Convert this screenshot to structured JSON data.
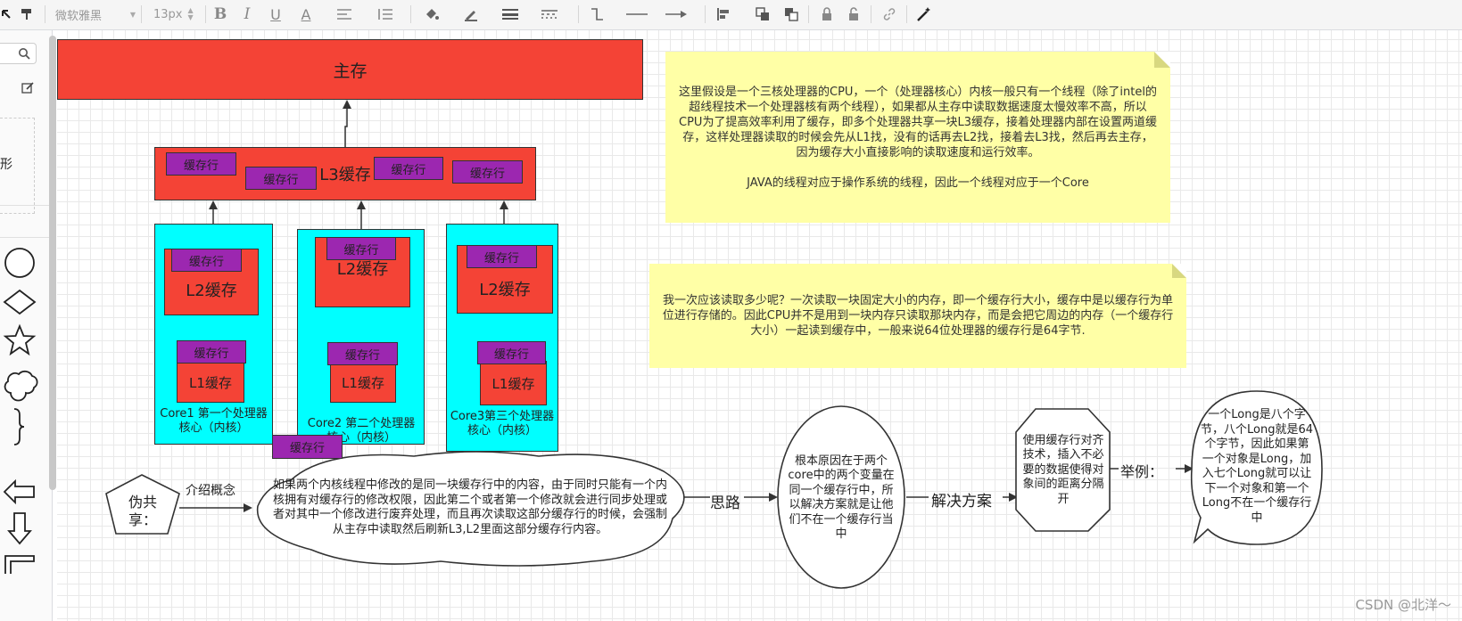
{
  "toolbar": {
    "font_family": "微软雅黑",
    "font_size": "13px"
  },
  "left_panel": {
    "shape_label": "形"
  },
  "main_memory": "主存",
  "l3": {
    "label": "L3缓存",
    "cache_lines": [
      "缓存行",
      "缓存行",
      "缓存行",
      "缓存行"
    ]
  },
  "cores": [
    {
      "label": "Core1 第一个处理器核心（内核）",
      "l2": "L2缓存",
      "l2_line": "缓存行",
      "l1": "L1缓存",
      "l1_line": "缓存行"
    },
    {
      "label": "Core2 第二个处理器核心（内核）",
      "l2": "L2缓存",
      "l2_line": "缓存行",
      "l1": "L1缓存",
      "l1_line": "缓存行"
    },
    {
      "label": "Core3第三个处理器核心（内核）",
      "l2": "L2缓存",
      "l2_line": "缓存行",
      "l1": "L1缓存",
      "l1_line": "缓存行"
    }
  ],
  "loose_cache_line": "缓存行",
  "notes": {
    "note1_p1": "这里假设是一个三核处理器的CPU，一个（处理器核心）内核一般只有一个线程（除了intel的超线程技术一个处理器核有两个线程），如果都从主存中读取数据速度太慢效率不高，所以CPU为了提高效率利用了缓存，即多个处理器共享一块L3缓存，接着处理器内部在设置两道缓存，这样处理器读取的时候会先从L1找，没有的话再去L2找，接着去L3找，然后再去主存，因为缓存大小直接影响的读取速度和运行效率。",
    "note1_p2": "JAVA的线程对应于操作系统的线程，因此一个线程对应于一个Core",
    "note2": "我一次应该读取多少呢？一次读取一块固定大小的内存，即一个缓存行大小，缓存中是以缓存行为单位进行存储的。因此CPU并不是用到一块内存只读取那块内存，而是会把它周边的内存（一个缓存行大小）一起读到缓存中，一般来说64位处理器的缓存行是64字节."
  },
  "flow": {
    "false_sharing": "伪共享：",
    "intro_label": "介绍概念",
    "cloud_text": "如果两个内核线程中修改的是同一块缓存行中的内容，由于同时只能有一个内核拥有对缓存行的修改权限，因此第二个或者第一个修改就会进行同步处理或者对其中一个修改进行废弃处理，而且再次读取这部分缓存行的时候，会强制从主存中读取然后刷新L3,L2里面这部分缓存行内容。",
    "thinking": "思路",
    "root_cause": "根本原因在于两个core中的两个变量在同一个缓存行中，所以解决方案就是让他们不在一个缓存行当中",
    "solution": "解决方案",
    "solution_text": "使用缓存行对齐技术，插入不必要的数据使得对象间的距离分隔开",
    "example": "举例：",
    "example_text": "一个Long是八个字节，八个Long就是64个字节，因此如果第一个对象是Long，加入七个Long就可以让下一个对象和第一个Long不在一个缓存行中"
  },
  "watermark": "CSDN @北洋～",
  "colors": {
    "red": "#f44336",
    "purple": "#9c27b0",
    "cyan": "#00ffff",
    "note_yellow": "#ffffa6"
  }
}
